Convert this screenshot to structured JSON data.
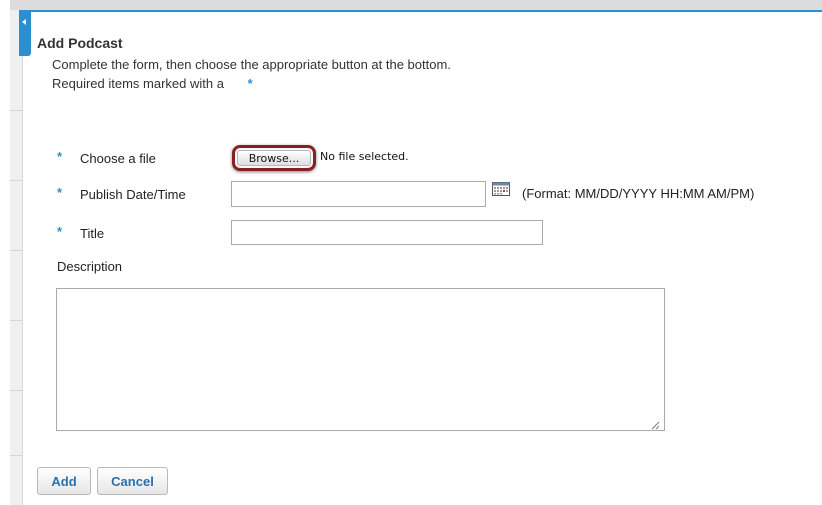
{
  "form": {
    "title": "Add Podcast",
    "instructions": "Complete the form, then choose the appropriate button at the bottom.",
    "required_note": "Required items marked with a",
    "required_marker": "*"
  },
  "fields": {
    "file": {
      "label": "Choose a file",
      "browse_label": "Browse...",
      "status": "No file selected."
    },
    "publish_date": {
      "label": "Publish Date/Time",
      "value": "",
      "format_hint": "(Format: MM/DD/YYYY HH:MM AM/PM)"
    },
    "title": {
      "label": "Title",
      "value": ""
    },
    "description": {
      "label": "Description",
      "value": ""
    }
  },
  "actions": {
    "add_label": "Add",
    "cancel_label": "Cancel"
  },
  "colors": {
    "accent": "#2d8fcf",
    "highlight": "#8b1f1f",
    "button_text": "#2d6fa8"
  },
  "icons": {
    "calendar": "calendar-icon",
    "collapse": "collapse-arrow-icon",
    "resize": "resize-grip-icon"
  }
}
